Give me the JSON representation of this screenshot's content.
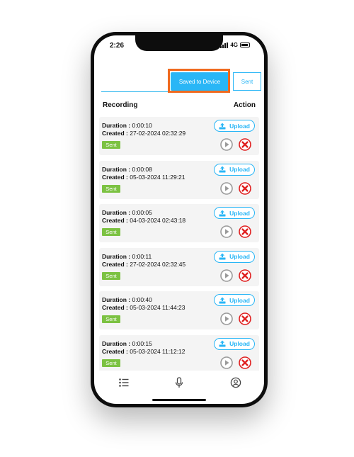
{
  "status": {
    "time": "2:26",
    "network": "4G"
  },
  "tabs": {
    "saved": "Saved to Device",
    "sent": "Sent"
  },
  "header": {
    "recording": "Recording",
    "action": "Action"
  },
  "labels": {
    "duration": "Duration :",
    "created": "Created :",
    "upload": "Upload"
  },
  "recordings": [
    {
      "duration": "0:00:10",
      "created": "27-02-2024 02:32:29",
      "status": "Sent"
    },
    {
      "duration": "0:00:08",
      "created": "05-03-2024 11:29:21",
      "status": "Sent"
    },
    {
      "duration": "0:00:05",
      "created": "04-03-2024 02:43:18",
      "status": "Sent"
    },
    {
      "duration": "0:00:11",
      "created": "27-02-2024 02:32:45",
      "status": "Sent"
    },
    {
      "duration": "0:00:40",
      "created": "05-03-2024 11:44:23",
      "status": "Sent"
    },
    {
      "duration": "0:00:15",
      "created": "05-03-2024 11:12:12",
      "status": "Sent"
    }
  ],
  "nav": [
    "list-icon",
    "microphone-icon",
    "profile-icon"
  ],
  "colors": {
    "accent": "#29b6f6",
    "sent_badge": "#7cc242",
    "highlight": "#f06a1f",
    "delete": "#e02020"
  }
}
